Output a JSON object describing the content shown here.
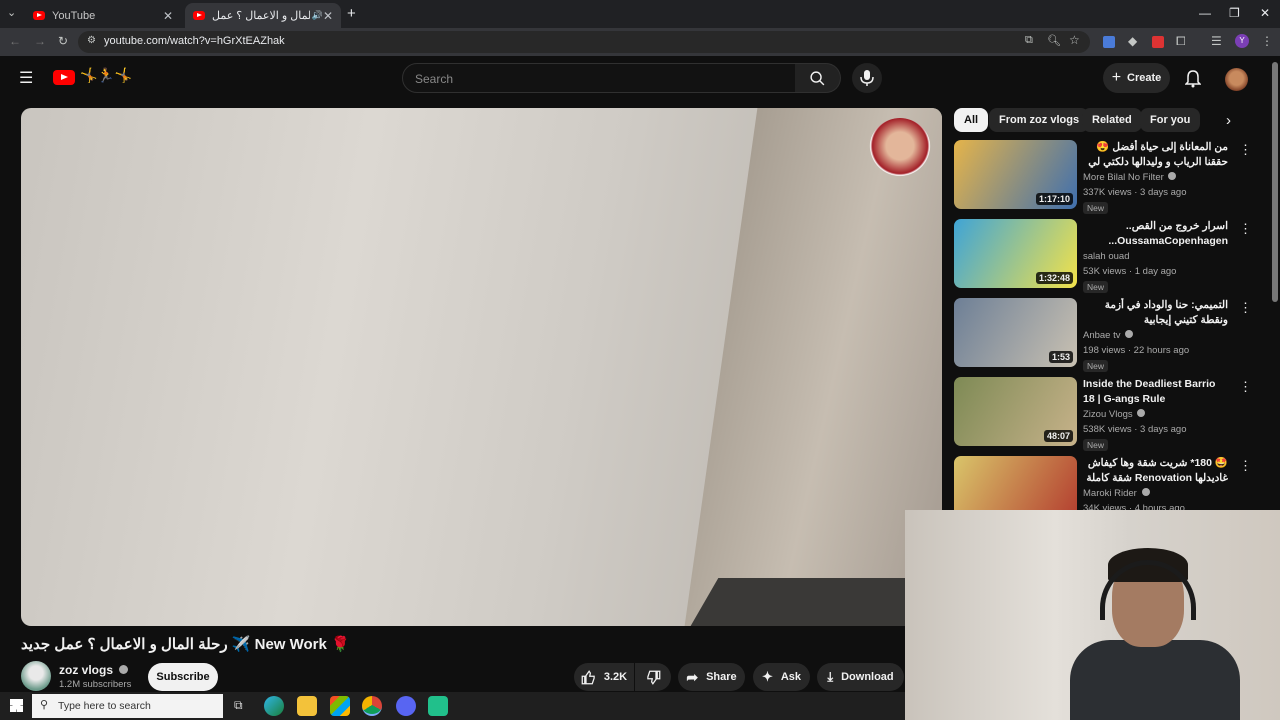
{
  "browser": {
    "tabs": [
      {
        "label": "YouTube",
        "active": false
      },
      {
        "label": "رحلة المال و الاعمال ؟ عمل ...",
        "active": true
      }
    ],
    "new_tab": "+",
    "url": "youtube.com/watch?v=hGrXtEAZhak",
    "window_controls": [
      "minimize-icon",
      "restore-icon",
      "close-icon"
    ],
    "profile_initial": "Y"
  },
  "youtube": {
    "search_placeholder": "Search",
    "create_label": "Create"
  },
  "chips": [
    "All",
    "From zoz vlogs",
    "Related",
    "For you"
  ],
  "recommendations": [
    {
      "title": "من المعاناة إلى حياة أفضل 😍 حققنا الرياب و وليدالها دلكتي لي كانت كانحلم بيه",
      "channel": "More Bilal No Filter",
      "verified": true,
      "meta": "337K views · 3 days ago",
      "badge": "New",
      "duration": "1:17:10",
      "thumb_colors": [
        "#e5b44a",
        "#3f6fae"
      ]
    },
    {
      "title": "اسرار خروج من القص.. OussamaCopenhagen...",
      "channel": "salah ouad",
      "verified": false,
      "meta": "53K views · 1 day ago",
      "badge": "New",
      "duration": "1:32:48",
      "thumb_colors": [
        "#3fa4d6",
        "#f2e24a"
      ]
    },
    {
      "title": "التميمي: حنا والوداد في أزمة ونقطة كتيني إيجابية",
      "channel": "Anbae tv",
      "verified": true,
      "meta": "198 views · 22 hours ago",
      "badge": "New",
      "duration": "1:53",
      "thumb_colors": [
        "#6d7f96",
        "#c9c1b2"
      ]
    },
    {
      "title": "Inside the Deadliest Barrio 18 | G-angs Rule",
      "channel": "Zizou Vlogs",
      "verified": true,
      "meta": "538K views · 3 days ago",
      "badge": "New",
      "duration": "48:07",
      "thumb_colors": [
        "#7e8a55",
        "#c7b28a"
      ]
    },
    {
      "title": "🤩 180* شريت شقة وها كيفاش غاديدلها Renovation شقة كاملة وبشحال 💰 👇",
      "channel": "Maroki Rider",
      "verified": true,
      "meta": "34K views · 4 hours ago",
      "badge": "",
      "duration": "",
      "thumb_colors": [
        "#d9c56a",
        "#b33b2e"
      ]
    }
  ],
  "video": {
    "title": "رحلة المال و الاعمال ؟ عمل جديد ✈️ New Work 🌹",
    "channel": "zoz vlogs",
    "subscribers": "1.2M subscribers",
    "subscribe_label": "Subscribe",
    "likes": "3.2K",
    "share_label": "Share",
    "ask_label": "Ask",
    "download_label": "Download"
  },
  "taskbar": {
    "search_placeholder": "Type here to search"
  }
}
